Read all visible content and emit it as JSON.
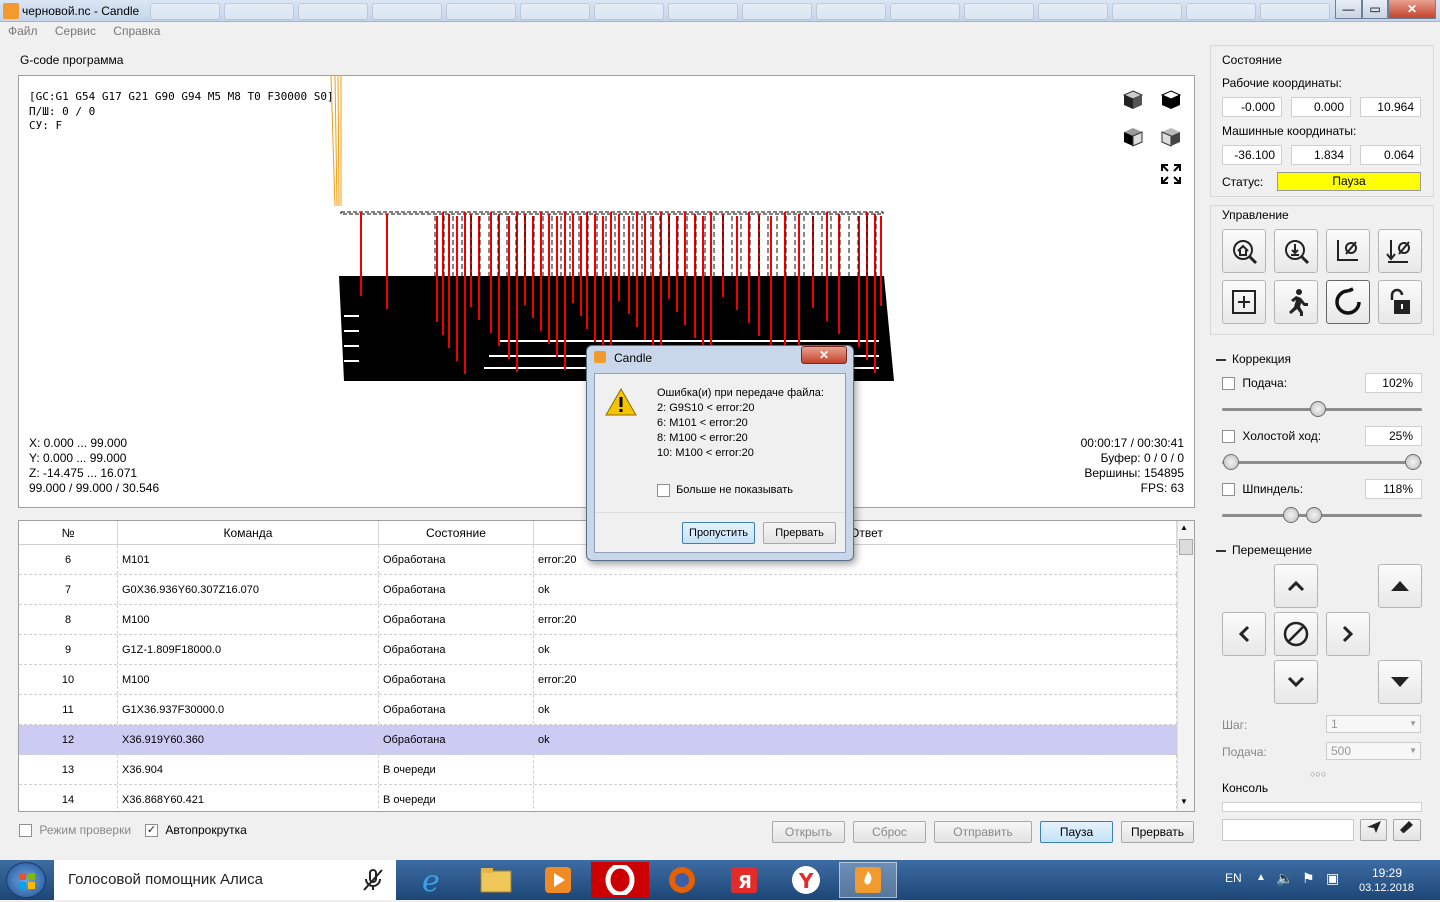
{
  "window": {
    "title": "черновой.nc - Candle"
  },
  "menu": [
    "Файл",
    "Сервис",
    "Справка"
  ],
  "viewer": {
    "group_label": "G-code программа",
    "gc_state": "[GC:G1 G54 G17 G21 G90 G94 M5 M8 T0 F30000 S0]",
    "feed_line": "П/Ш: 0 / 0",
    "cu_line": "СУ: F",
    "range_x": "X: 0.000 ... 99.000",
    "range_y": "Y: 0.000 ... 99.000",
    "range_z": "Z: -14.475 ... 16.071",
    "size_line": "99.000 / 99.000 / 30.546",
    "time": "00:00:17 / 00:30:41",
    "buffer": "Буфер: 0 / 0 / 0",
    "vertices": "Вершины: 154895",
    "fps": "FPS: 63",
    "view_icons": [
      "cube-front-icon",
      "cube-top-icon",
      "cube-left-icon",
      "cube-iso-icon",
      "fullscreen-icon"
    ]
  },
  "table": {
    "headers": [
      "№",
      "Команда",
      "Состояние",
      "Ответ"
    ],
    "rows": [
      {
        "n": "6",
        "cmd": "M101",
        "state": "Обработана",
        "resp": "error:20"
      },
      {
        "n": "7",
        "cmd": "G0X36.936Y60.307Z16.070",
        "state": "Обработана",
        "resp": "ok"
      },
      {
        "n": "8",
        "cmd": "M100",
        "state": "Обработана",
        "resp": "error:20"
      },
      {
        "n": "9",
        "cmd": "G1Z-1.809F18000.0",
        "state": "Обработана",
        "resp": "ok"
      },
      {
        "n": "10",
        "cmd": "M100",
        "state": "Обработана",
        "resp": "error:20"
      },
      {
        "n": "11",
        "cmd": "G1X36.937F30000.0",
        "state": "Обработана",
        "resp": "ok"
      },
      {
        "n": "12",
        "cmd": "X36.919Y60.360",
        "state": "Обработана",
        "resp": "ok"
      },
      {
        "n": "13",
        "cmd": "X36.904",
        "state": "В очереди",
        "resp": ""
      },
      {
        "n": "14",
        "cmd": "X36.868Y60.421",
        "state": "В очереди",
        "resp": ""
      }
    ],
    "selected_row_index": 6
  },
  "bottom": {
    "check_mode": "Режим проверки",
    "autoscroll": "Автопрокрутка",
    "btn_open": "Открыть",
    "btn_reset": "Сброс",
    "btn_send": "Отправить",
    "btn_pause": "Пауза",
    "btn_abort": "Прервать"
  },
  "state_panel": {
    "title": "Состояние",
    "work_label": "Рабочие координаты:",
    "work": [
      "-0.000",
      "0.000",
      "10.964"
    ],
    "machine_label": "Машинные координаты:",
    "machine": [
      "-36.100",
      "1.834",
      "0.064"
    ],
    "status_label": "Статус:",
    "status_value": "Пауза",
    "status_color": "#ffff00"
  },
  "control": {
    "title": "Управление",
    "buttons": [
      "home-icon",
      "zero-probe-icon",
      "zero-xy-icon",
      "zero-z-icon",
      "origin-icon",
      "safe-position-icon",
      "reset-icon",
      "unlock-icon"
    ]
  },
  "correction": {
    "title": "Коррекция",
    "feed_label": "Подача:",
    "feed_value": "102%",
    "feed_level": 0.58,
    "rapid_label": "Холостой ход:",
    "rapid_value": "25%",
    "spindle_label": "Шпиндель:",
    "spindle_value": "118%"
  },
  "jog": {
    "title": "Перемещение",
    "step_label": "Шаг:",
    "step_value": "1",
    "feed_label": "Подача:",
    "feed_value": "500"
  },
  "console": {
    "title": "Консоль"
  },
  "dialog": {
    "title": "Candle",
    "message": "Ошибка(и) при передаче файла:",
    "errors": [
      "2: G9S10 < error:20",
      "6: M101 < error:20",
      "8: M100 < error:20",
      "10: M100 < error:20"
    ],
    "dont_show": "Больше не показывать",
    "btn_skip": "Пропустить",
    "btn_abort": "Прервать"
  },
  "taskbar": {
    "assistant": "Голосовой помощник Алиса",
    "lang": "EN",
    "time": "19:29",
    "date": "03.12.2018"
  }
}
